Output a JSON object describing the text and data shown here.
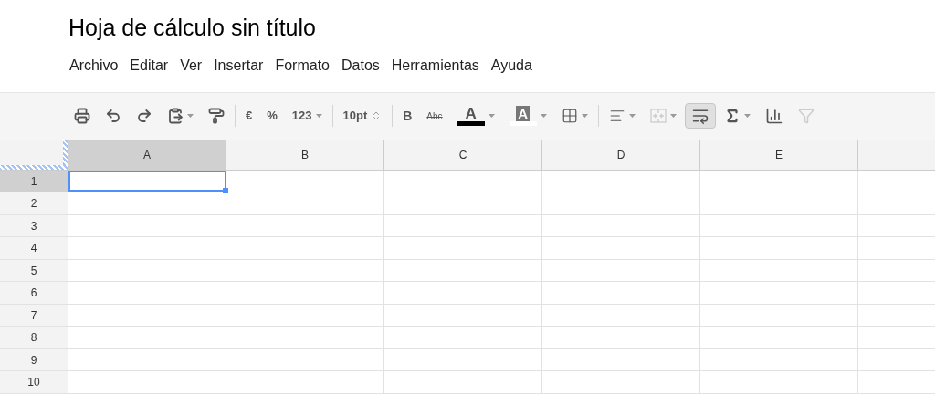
{
  "document": {
    "title": "Hoja de cálculo sin título"
  },
  "menu": [
    "Archivo",
    "Editar",
    "Ver",
    "Insertar",
    "Formato",
    "Datos",
    "Herramientas",
    "Ayuda"
  ],
  "toolbar": [
    [
      {
        "kind": "print",
        "dropdown": false,
        "disabled": false,
        "selected": false
      },
      {
        "kind": "undo",
        "dropdown": false,
        "disabled": false,
        "selected": false
      },
      {
        "kind": "redo",
        "dropdown": false,
        "disabled": false,
        "selected": false
      },
      {
        "kind": "paste",
        "dropdown": true,
        "disabled": false,
        "selected": false
      },
      {
        "kind": "roller",
        "dropdown": false,
        "disabled": false,
        "selected": false
      }
    ],
    [
      {
        "kind": "text",
        "label": "€",
        "dropdown": false,
        "disabled": false,
        "selected": false
      },
      {
        "kind": "text",
        "label": "%",
        "dropdown": false,
        "disabled": false,
        "selected": false
      },
      {
        "kind": "text",
        "label": "123",
        "dropdown": true,
        "disabled": false,
        "selected": false
      }
    ],
    [
      {
        "kind": "size",
        "label": "10pt",
        "dropdown": false,
        "disabled": false,
        "selected": false
      }
    ],
    [
      {
        "kind": "bold",
        "label": "B",
        "dropdown": false,
        "disabled": false,
        "selected": false
      },
      {
        "kind": "strike",
        "label": "Abc",
        "dropdown": false,
        "disabled": false,
        "selected": false
      },
      {
        "kind": "textcolor",
        "label": "A",
        "color": "#000000",
        "dropdown": true,
        "disabled": false,
        "selected": false
      },
      {
        "kind": "fillcolor",
        "label": "A",
        "color": "#ffffff",
        "dropdown": true,
        "disabled": false,
        "selected": false
      },
      {
        "kind": "borders",
        "dropdown": true,
        "disabled": false,
        "selected": false
      }
    ],
    [
      {
        "kind": "align",
        "dropdown": true,
        "disabled": false,
        "selected": false
      },
      {
        "kind": "merge",
        "dropdown": true,
        "disabled": true,
        "selected": false
      },
      {
        "kind": "wrap",
        "dropdown": false,
        "disabled": false,
        "selected": true
      },
      {
        "kind": "sum",
        "dropdown": true,
        "disabled": false,
        "selected": false
      },
      {
        "kind": "chart",
        "dropdown": false,
        "disabled": false,
        "selected": false
      },
      {
        "kind": "filter",
        "dropdown": false,
        "disabled": true,
        "selected": false
      }
    ]
  ],
  "grid": {
    "columns": [
      {
        "label": "A",
        "selected": true
      },
      {
        "label": "B",
        "selected": false
      },
      {
        "label": "C",
        "selected": false
      },
      {
        "label": "D",
        "selected": false
      },
      {
        "label": "E",
        "selected": false
      }
    ],
    "rows": [
      {
        "label": "1",
        "selected": true
      },
      {
        "label": "2",
        "selected": false
      },
      {
        "label": "3",
        "selected": false
      },
      {
        "label": "4",
        "selected": false
      },
      {
        "label": "5",
        "selected": false
      },
      {
        "label": "6",
        "selected": false
      },
      {
        "label": "7",
        "selected": false
      },
      {
        "label": "8",
        "selected": false
      },
      {
        "label": "9",
        "selected": false
      },
      {
        "label": "10",
        "selected": false
      }
    ]
  }
}
